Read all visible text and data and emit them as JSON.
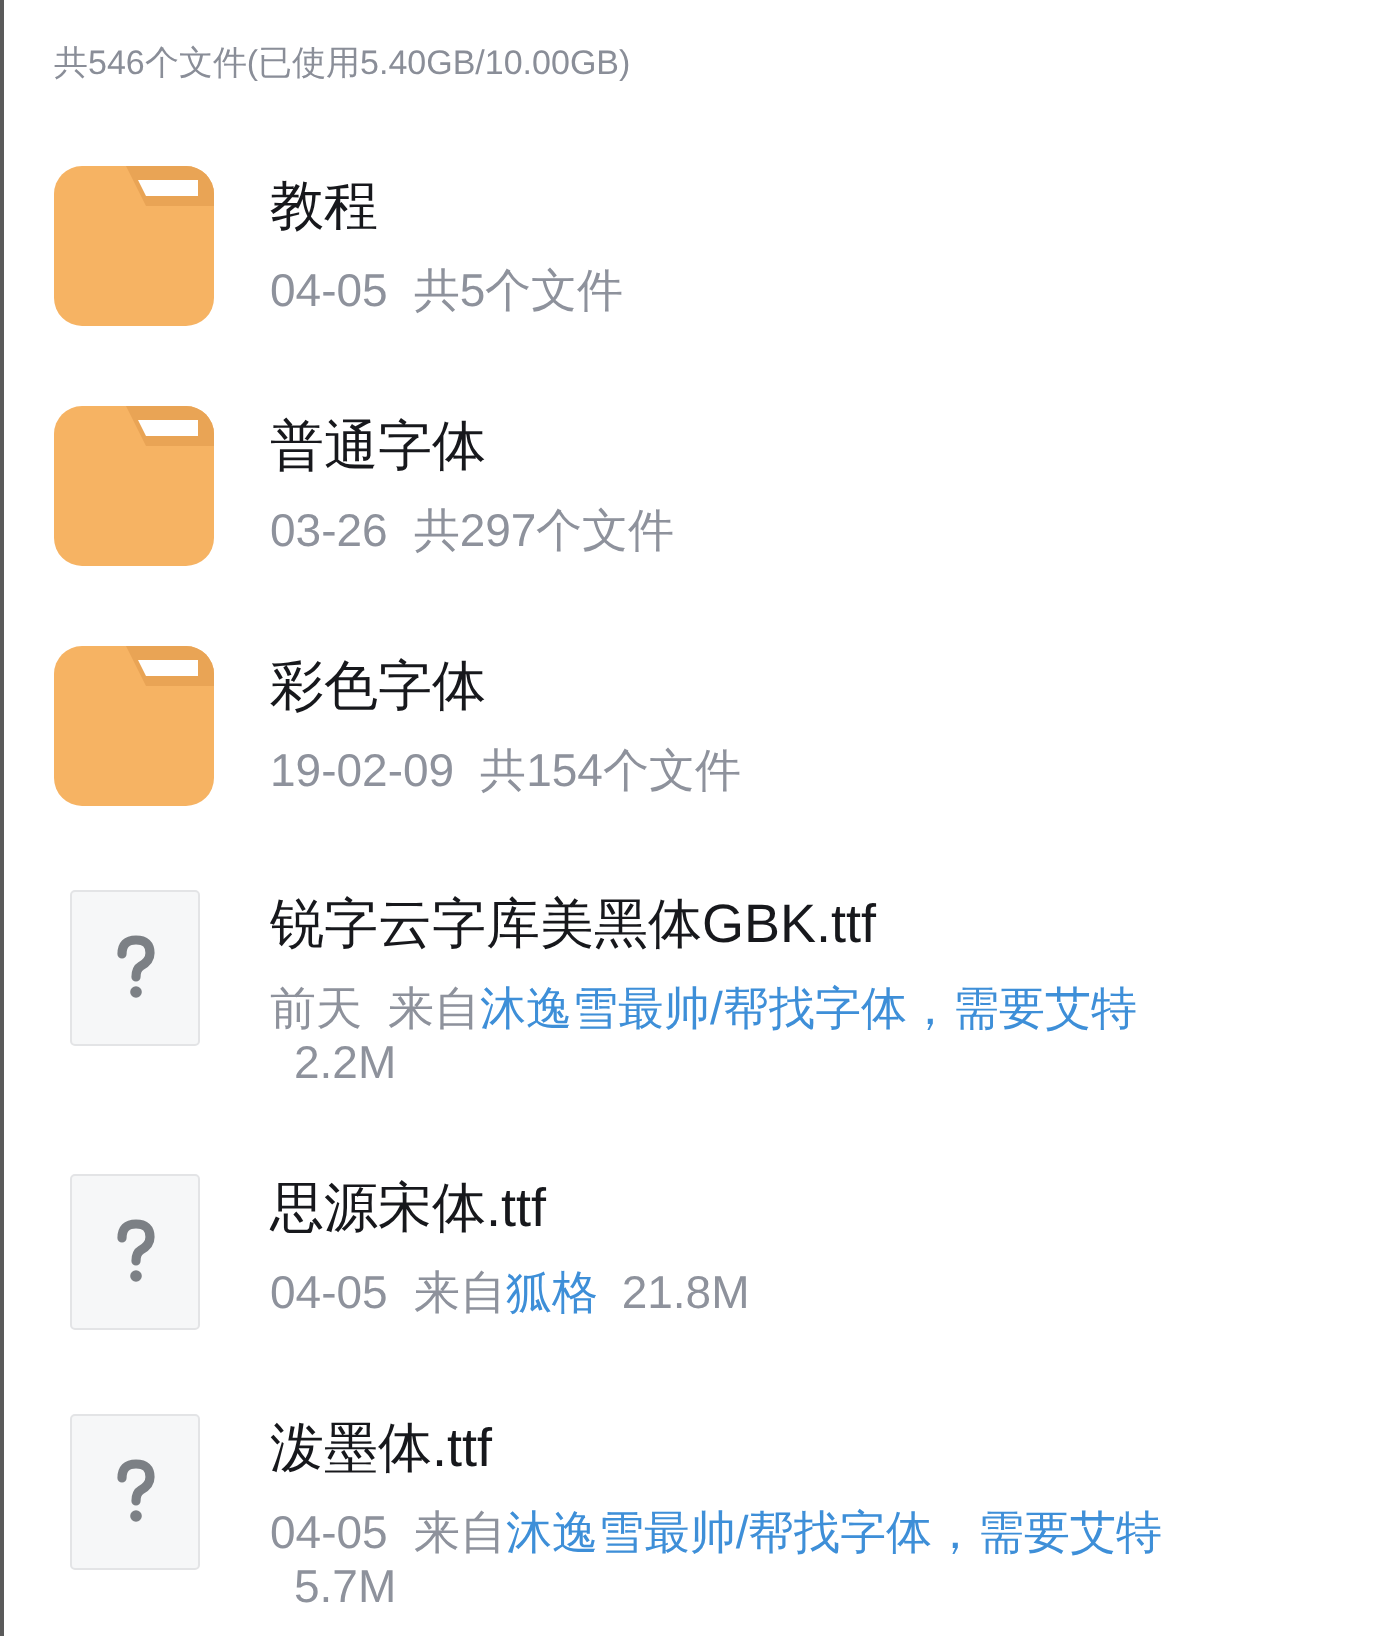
{
  "summary": "共546个文件(已使用5.40GB/10.00GB)",
  "items": [
    {
      "kind": "folder",
      "name": "教程",
      "date": "04-05",
      "count": "共5个文件"
    },
    {
      "kind": "folder",
      "name": "普通字体",
      "date": "03-26",
      "count": "共297个文件"
    },
    {
      "kind": "folder",
      "name": "彩色字体",
      "date": "19-02-09",
      "count": "共154个文件"
    },
    {
      "kind": "file",
      "name": "锐字云字库美黑体GBK.ttf",
      "date": "前天",
      "source_label": "来自",
      "source": "沐逸雪最帅/帮找字体，需要艾特",
      "size": "2.2M"
    },
    {
      "kind": "file",
      "name": "思源宋体.ttf",
      "date": "04-05",
      "source_label": "来自",
      "source": "狐格",
      "size": "21.8M"
    },
    {
      "kind": "file",
      "name": "泼墨体.ttf",
      "date": "04-05",
      "source_label": "来自",
      "source": "沐逸雪最帅/帮找字体，需要艾特",
      "size": "5.7M"
    }
  ]
}
